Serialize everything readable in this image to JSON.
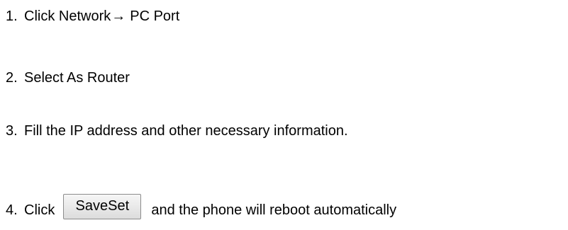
{
  "steps": [
    {
      "number": "1.",
      "text_before": "Click Network",
      "arrow": "→",
      "text_after": "PC Port"
    },
    {
      "number": "2.",
      "text": "Select As Router"
    },
    {
      "number": "3.",
      "text": "Fill the IP address and other necessary information."
    },
    {
      "number": "4.",
      "text_before": "Click",
      "button_label": "SaveSet",
      "text_after": "and the phone will reboot automatically"
    }
  ]
}
